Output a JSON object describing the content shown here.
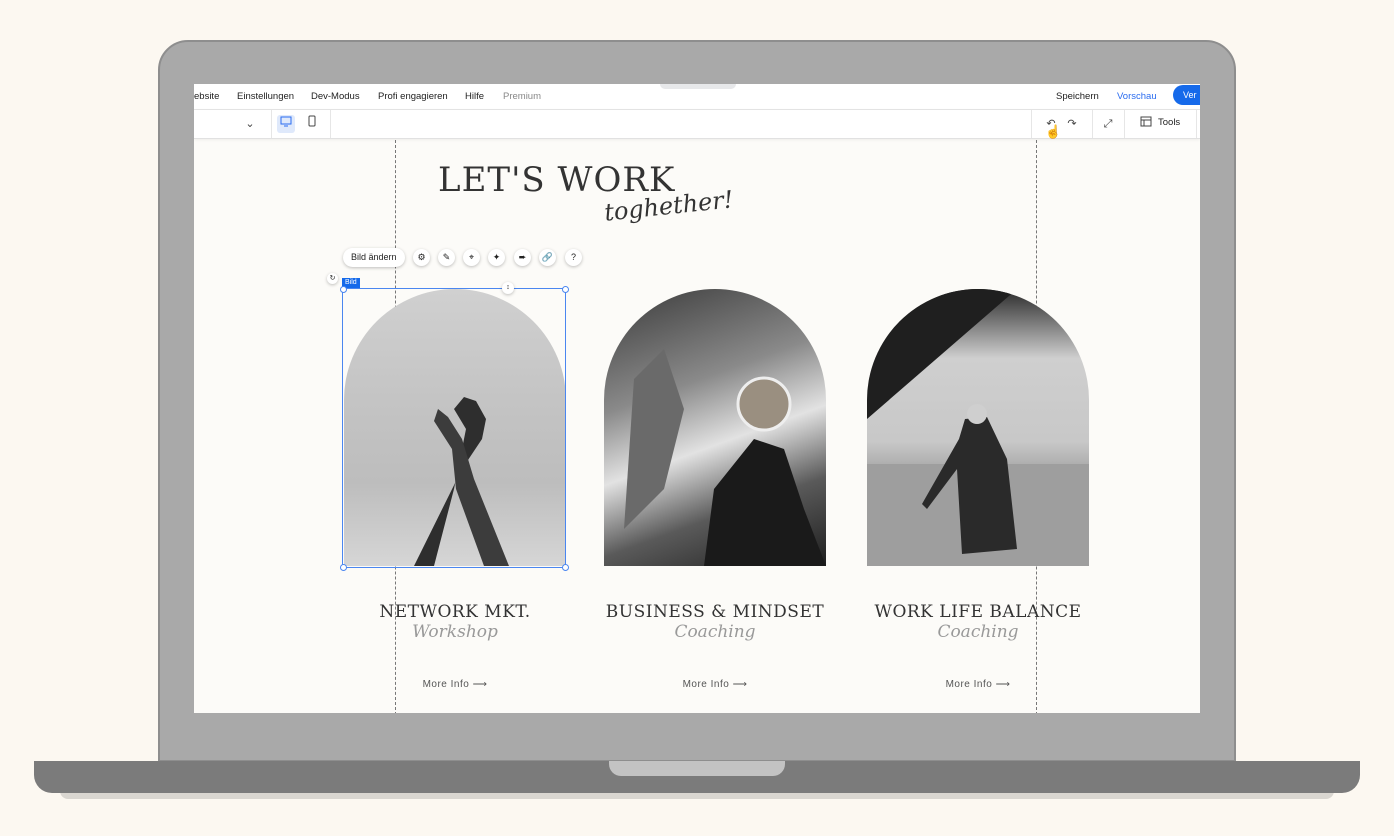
{
  "menu": {
    "items": [
      "ebsite",
      "Einstellungen",
      "Dev-Modus",
      "Profi engagieren",
      "Hilfe",
      "Premium"
    ],
    "save": "Speichern",
    "preview": "Vorschau",
    "publish": "Ver"
  },
  "toolbar": {
    "tools_label": "Tools",
    "icons": [
      "chevron-down-icon",
      "desktop-icon",
      "mobile-icon",
      "undo-icon",
      "redo-icon",
      "fit-to-screen-icon",
      "tools-panel-icon"
    ]
  },
  "page": {
    "title": "LET'S WORK",
    "title_script": "toghether!"
  },
  "image_toolbar": {
    "change_label": "Bild ändern",
    "icons": [
      "settings-icon",
      "edit-icon",
      "crop-icon",
      "magic-icon",
      "animation-icon",
      "link-icon",
      "help-icon"
    ],
    "selection_tag": "Bild"
  },
  "cards": [
    {
      "title": "NETWORK MKT.",
      "subtitle": "Workshop",
      "link": "More Info ⟶"
    },
    {
      "title": "BUSINESS & MINDSET",
      "subtitle": "Coaching",
      "link": "More Info ⟶"
    },
    {
      "title": "WORK LIFE BALANCE",
      "subtitle": "Coaching",
      "link": "More Info ⟶"
    }
  ],
  "colors": {
    "accent": "#166aea",
    "background": "#fcf8f1"
  }
}
